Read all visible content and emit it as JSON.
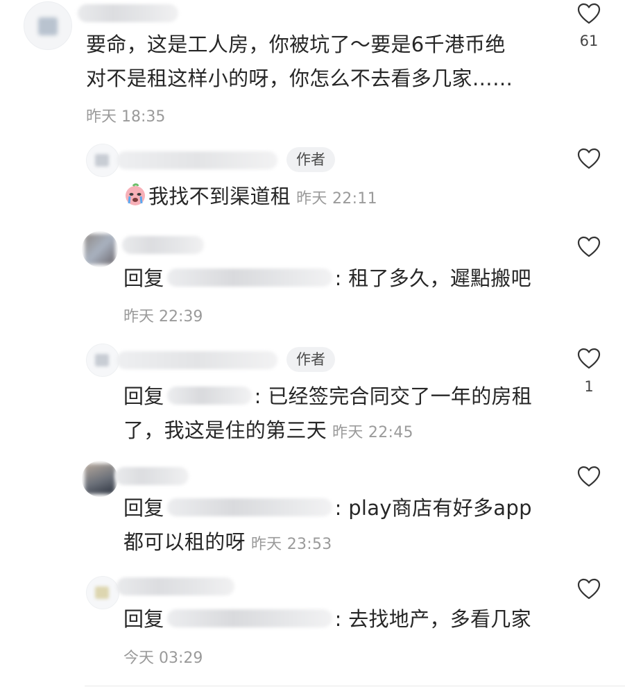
{
  "comments": [
    {
      "text_line1": "要命，这是工人房，你被坑了～要是6千港币绝",
      "text_line2": "对不是租这样小的呀，你怎么不去看多几家……",
      "time": "昨天 18:35",
      "likes": "61"
    }
  ],
  "replies": [
    {
      "author_badge": "作者",
      "text": "我找不到渠道租",
      "time": "昨天 22:11",
      "emoji": "crying-face-emoji"
    },
    {
      "reply_word": "回复",
      "text": ": 租了多久，遲點搬吧",
      "time": "昨天 22:39"
    },
    {
      "author_badge": "作者",
      "reply_word": "回复",
      "text_line1": ": 已经签完合同交了一年的房租",
      "text_line2": "了，我这是住的第三天",
      "time": "昨天 22:45",
      "likes": "1"
    },
    {
      "reply_word": "回复",
      "text_line1": ": play商店有好多app",
      "text_line2": "都可以租的呀",
      "time": "昨天 23:53"
    },
    {
      "reply_word": "回复",
      "text": ": 去找地产，多看几家",
      "time": "今天 03:29"
    }
  ],
  "icons": {
    "like": "heart-outline-icon"
  },
  "colors": {
    "text": "#262626",
    "muted": "#9a9a9a",
    "badge_bg": "#f0f1f3"
  }
}
